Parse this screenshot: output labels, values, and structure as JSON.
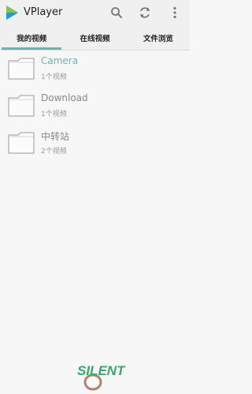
{
  "app": {
    "title": "VPlayer"
  },
  "toolbar": {
    "search_icon": "search-icon",
    "refresh_icon": "refresh-icon",
    "more_icon": "more-vert-icon"
  },
  "tabs": [
    {
      "label": "我的视频",
      "active": true
    },
    {
      "label": "在线视频",
      "active": false
    },
    {
      "label": "文件浏览",
      "active": false
    }
  ],
  "folders": [
    {
      "name": "Camera",
      "count": "1个视频",
      "highlighted": true
    },
    {
      "name": "Download",
      "count": "1个视频",
      "highlighted": false
    },
    {
      "name": "中转站",
      "count": "2个视频",
      "highlighted": false
    }
  ],
  "colors": {
    "accent": "#6fb3aa",
    "logo_green": "#4caf50",
    "logo_blue": "#2196f3"
  },
  "watermark": {
    "text": "SILENT"
  }
}
